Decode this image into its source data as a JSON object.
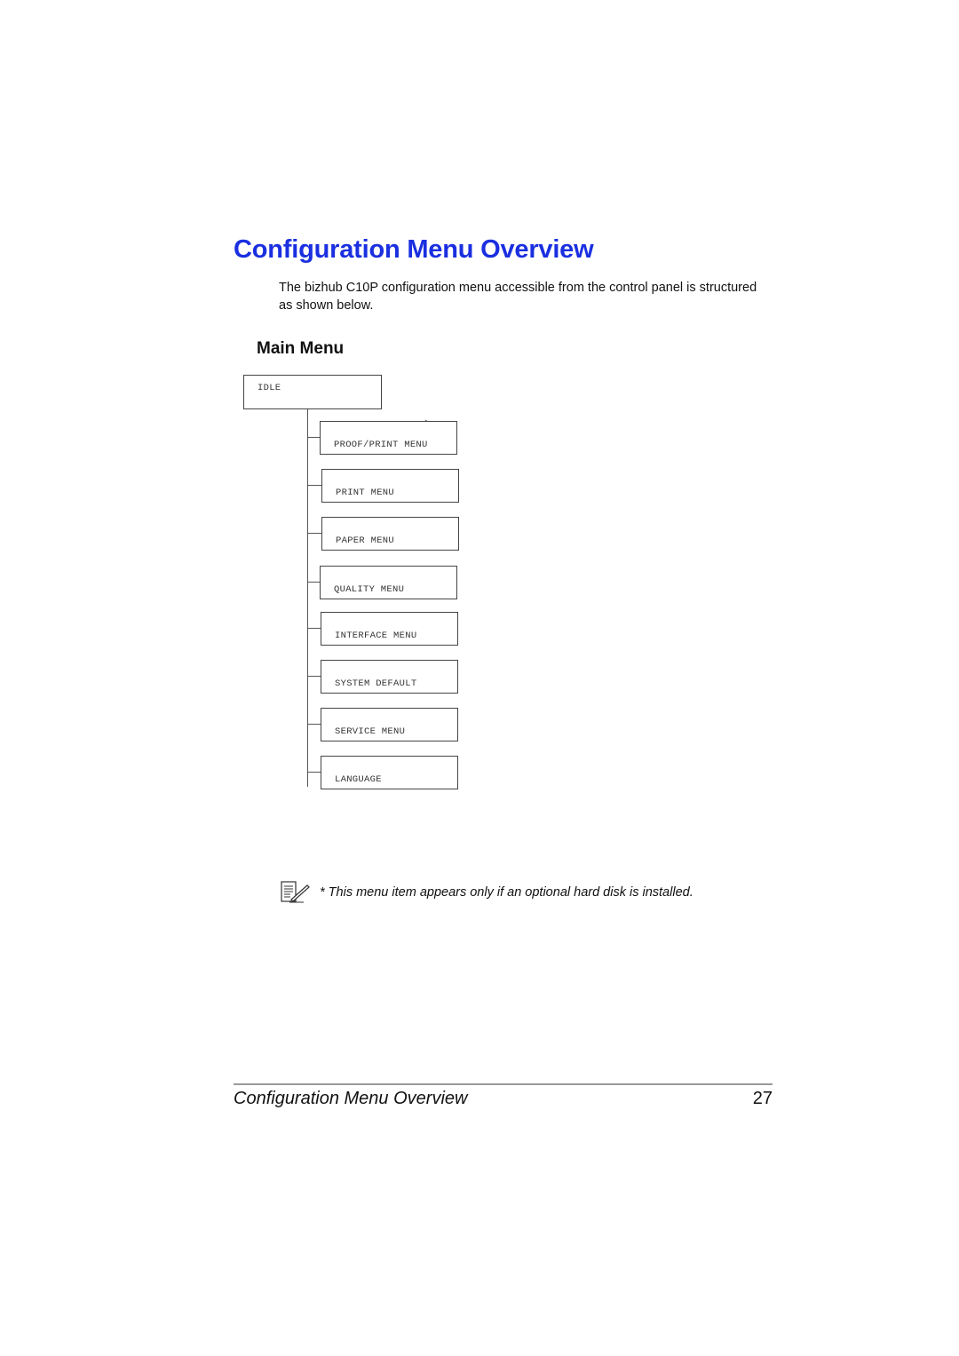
{
  "page": {
    "title": "Configuration Menu Overview",
    "intro": "The bizhub C10P configuration menu accessible from the control panel is structured as shown below.",
    "section_title": "Main Menu"
  },
  "menu_tree": {
    "root": "IDLE",
    "children": [
      {
        "label": "PROOF/PRINT MENU",
        "marker": "*"
      },
      {
        "label": "PRINT MENU",
        "marker": ""
      },
      {
        "label": "PAPER MENU",
        "marker": ""
      },
      {
        "label": "QUALITY MENU",
        "marker": ""
      },
      {
        "label": "INTERFACE MENU",
        "marker": ""
      },
      {
        "label": "SYSTEM DEFAULT",
        "marker": ""
      },
      {
        "label": "SERVICE MENU",
        "marker": ""
      },
      {
        "label": "LANGUAGE",
        "marker": ""
      }
    ]
  },
  "note": {
    "icon": "note-pencil-icon",
    "text": "* This menu item appears only if an optional hard disk is installed."
  },
  "footer": {
    "title": "Configuration Menu Overview",
    "page_number": "27"
  }
}
